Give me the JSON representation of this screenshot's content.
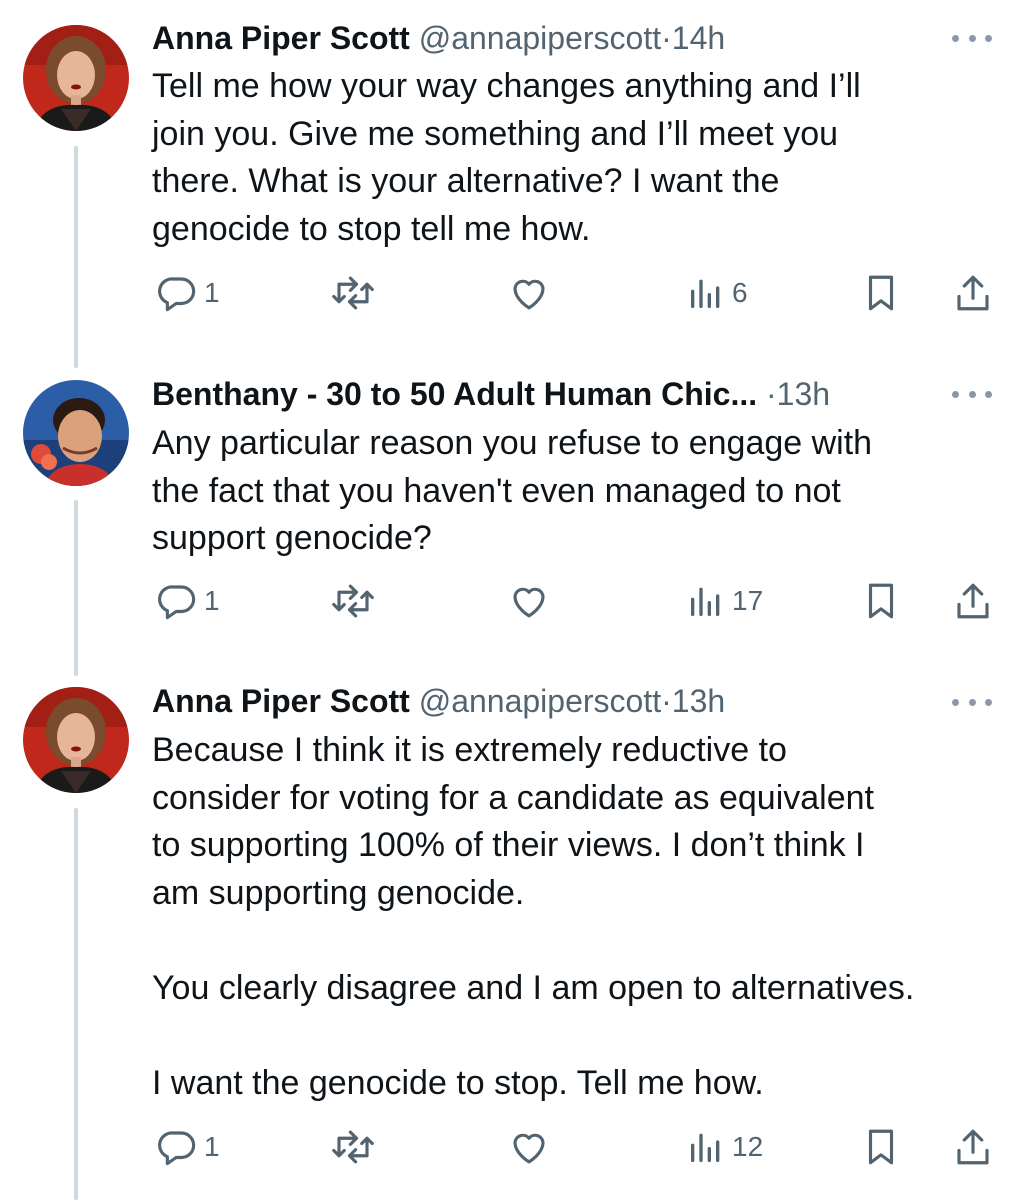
{
  "thread": [
    {
      "author_name": "Anna Piper Scott",
      "handle": "@annapiperscott",
      "separator": "·",
      "time": "14h",
      "text": "Tell me how your way changes anything and I’ll\njoin you. Give me something and I’ll meet you\nthere. What is your alternative? I want the\ngenocide to stop tell me how.",
      "reply_count": "1",
      "repost_count": "",
      "like_count": "",
      "view_count": "6"
    },
    {
      "author_name": "Benthany - 30 to 50 Adult Human Chic...",
      "handle": "",
      "separator": "·",
      "time": "13h",
      "text": "Any particular reason you refuse to engage with\nthe fact that you haven't even managed to not\nsupport genocide?",
      "reply_count": "1",
      "repost_count": "",
      "like_count": "",
      "view_count": "17"
    },
    {
      "author_name": "Anna Piper Scott",
      "handle": "@annapiperscott",
      "separator": "·",
      "time": "13h",
      "text": "Because I think it is extremely reductive to\nconsider for voting for a candidate as equivalent\nto supporting 100% of their views. I don’t think I\nam supporting genocide.\n\nYou clearly disagree and I am open to alternatives.\n\nI want the genocide to stop. Tell me how.",
      "reply_count": "1",
      "repost_count": "",
      "like_count": "",
      "view_count": "12"
    }
  ],
  "icons": {
    "reply": "reply-icon",
    "repost": "repost-icon",
    "like": "like-icon",
    "views": "views-icon",
    "bookmark": "bookmark-icon",
    "share": "share-icon",
    "more": "more-icon"
  },
  "colors": {
    "text": "#0f1419",
    "secondary": "#536471",
    "icon": "#536471",
    "thread_line": "#cfd9de"
  }
}
